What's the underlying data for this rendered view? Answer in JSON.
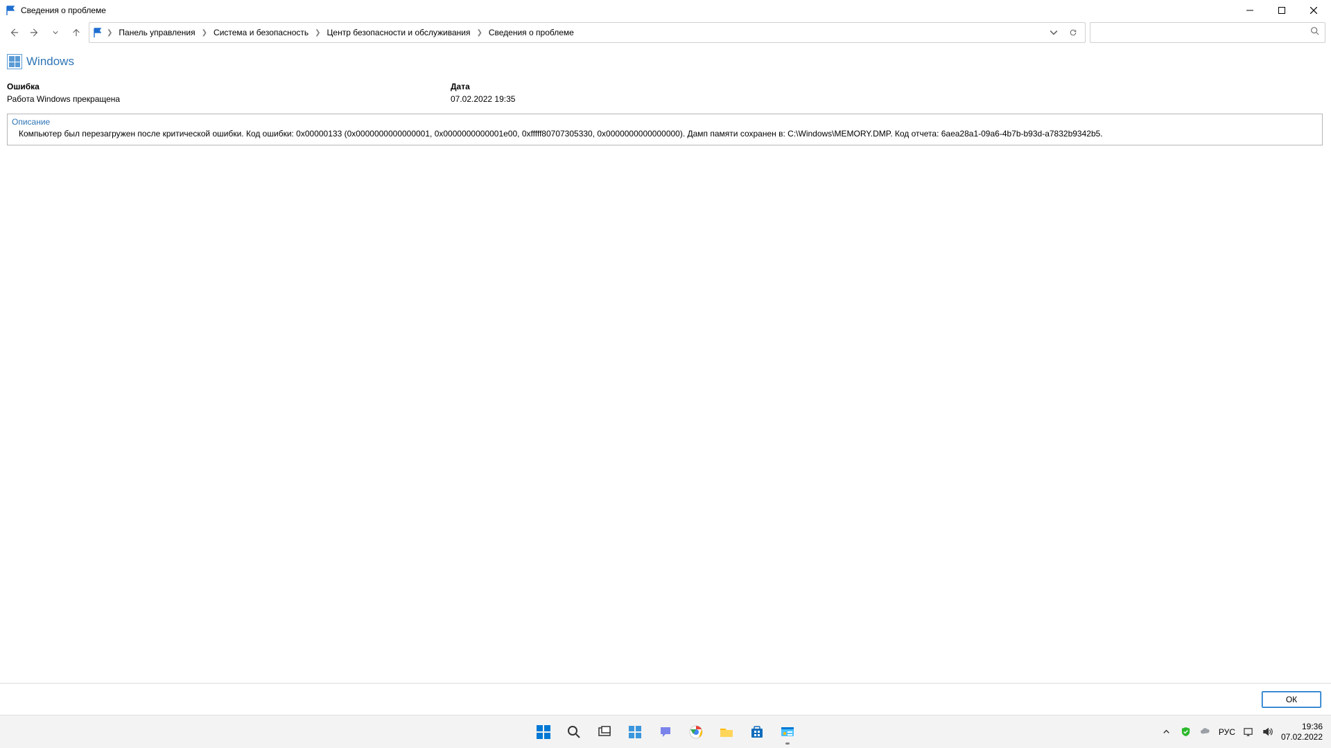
{
  "window": {
    "title": "Сведения о проблеме"
  },
  "breadcrumb": {
    "items": [
      "Панель управления",
      "Система и безопасность",
      "Центр безопасности и обслуживания",
      "Сведения о проблеме"
    ]
  },
  "search": {
    "placeholder": ""
  },
  "heading": "Windows",
  "labels": {
    "error": "Ошибка",
    "date": "Дата",
    "description": "Описание"
  },
  "values": {
    "error": "Работа Windows прекращена",
    "date": "07.02.2022 19:35",
    "description": "Компьютер был перезагружен после критической ошибки.  Код ошибки: 0x00000133 (0x0000000000000001, 0x0000000000001e00, 0xfffff80707305330, 0x0000000000000000). Дамп памяти сохранен в: C:\\Windows\\MEMORY.DMP. Код отчета: 6aea28a1-09a6-4b7b-b93d-a7832b9342b5."
  },
  "buttons": {
    "ok": "ОК"
  },
  "taskbar": {
    "lang": "РУС",
    "time": "19:36",
    "date": "07.02.2022"
  }
}
